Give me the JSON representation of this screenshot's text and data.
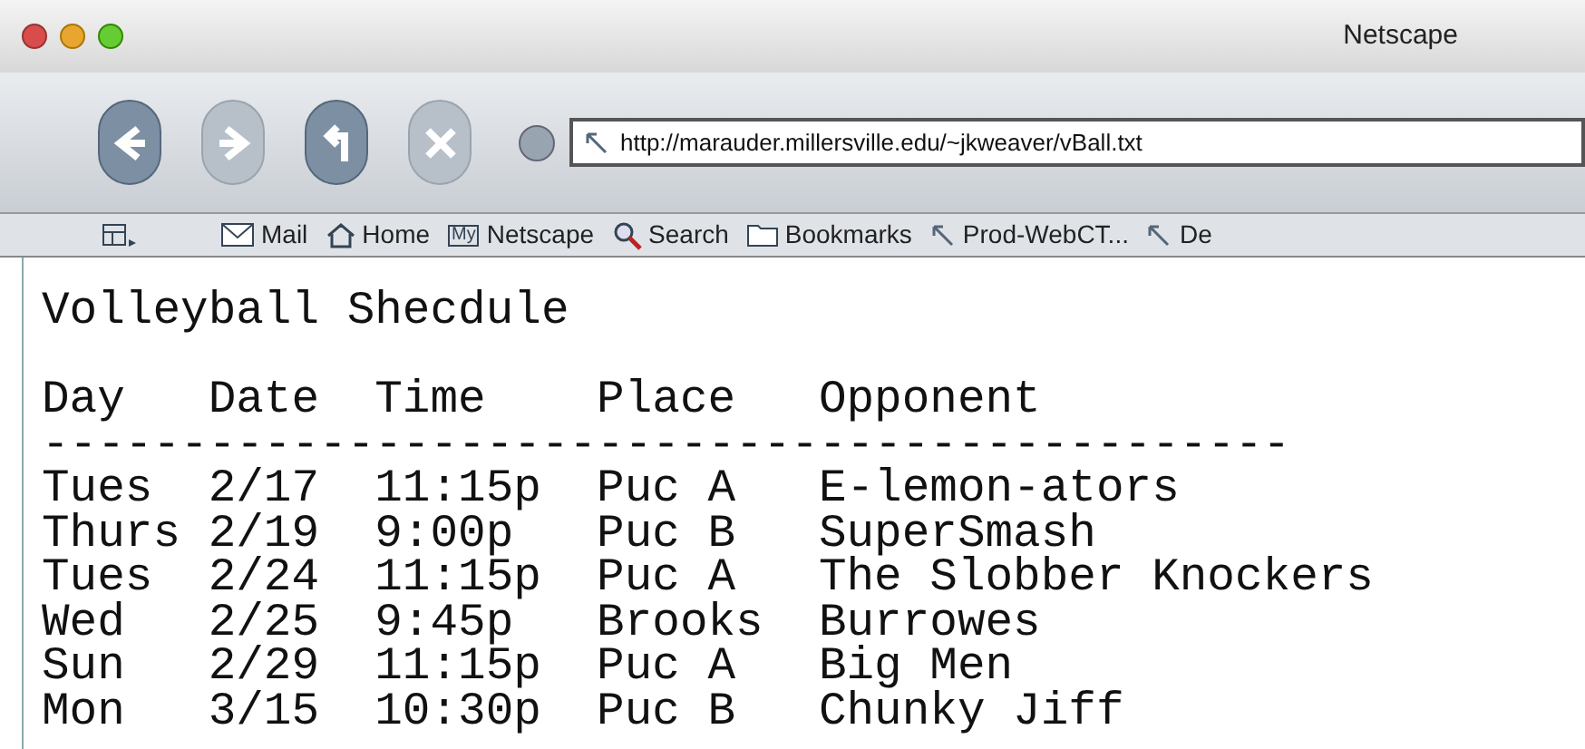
{
  "window": {
    "title": "Netscape"
  },
  "toolbar": {
    "buttons": [
      {
        "kind": "back",
        "disabled": false
      },
      {
        "kind": "forward",
        "disabled": true
      },
      {
        "kind": "reload",
        "disabled": false
      },
      {
        "kind": "stop",
        "disabled": true
      }
    ],
    "url": "http://marauder.millersville.edu/~jkweaver/vBall.txt"
  },
  "bookmarks": [
    {
      "kind": "mail",
      "label": "Mail"
    },
    {
      "kind": "home",
      "label": "Home"
    },
    {
      "kind": "my",
      "badge": "My",
      "label": "Netscape"
    },
    {
      "kind": "search",
      "label": "Search"
    },
    {
      "kind": "folder",
      "label": "Bookmarks"
    },
    {
      "kind": "link",
      "label": "Prod-WebCT..."
    },
    {
      "kind": "link",
      "label": "De"
    }
  ],
  "document": {
    "title": "Volleyball Shecdule",
    "columns": [
      "Day",
      "Date",
      "Time",
      "Place",
      "Opponent"
    ],
    "separator": "---------------------------------------------",
    "rows": [
      [
        "Tues",
        "2/17",
        "11:15p",
        "Puc A",
        "E-lemon-ators"
      ],
      [
        "Thurs",
        "2/19",
        "9:00p",
        "Puc B",
        "SuperSmash"
      ],
      [
        "Tues",
        "2/24",
        "11:15p",
        "Puc A",
        "The Slobber Knockers"
      ],
      [
        "Wed",
        "2/25",
        "9:45p",
        "Brooks",
        "Burrowes"
      ],
      [
        "Sun",
        "2/29",
        "11:15p",
        "Puc A",
        "Big Men"
      ],
      [
        "Mon",
        "3/15",
        "10:30p",
        "Puc B",
        "Chunky Jiff"
      ]
    ]
  }
}
